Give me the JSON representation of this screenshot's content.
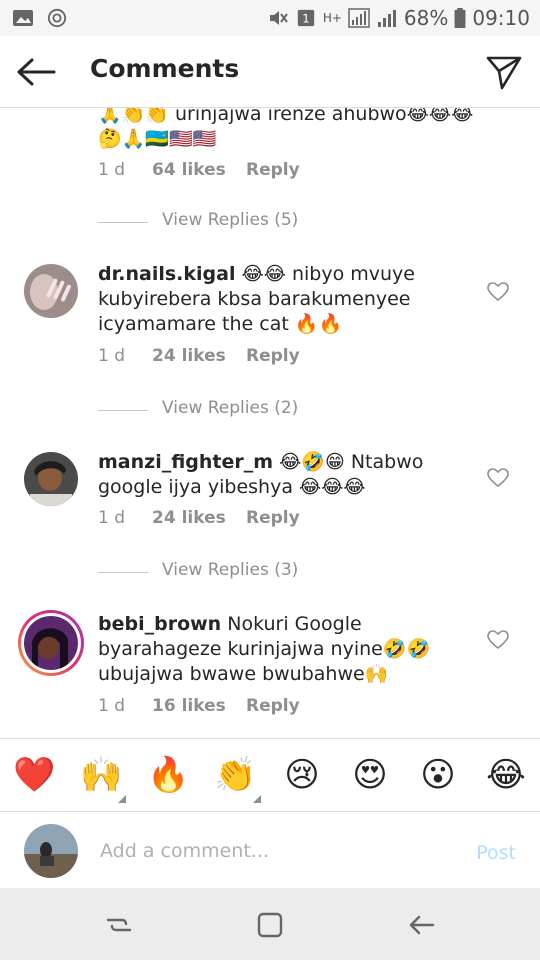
{
  "status_bar": {
    "battery_percent": "68%",
    "time": "09:10",
    "sim": "1",
    "network": "H+"
  },
  "header": {
    "title": "Comments"
  },
  "comments": [
    {
      "id": "c0",
      "text": "🙏👏👏 urinjajwa irenze ahubwo😂😂😂🤔🙏🇷🇼🇺🇸🇺🇸",
      "time": "1 d",
      "likes": "64 likes",
      "reply": "Reply",
      "view_replies": "View Replies (5)"
    },
    {
      "id": "c1",
      "username": "dr.nails.kigal",
      "text": " 😂😂 nibyo mvuye kubyirebera kbsa barakumenyee icyamamare the cat 🔥🔥",
      "time": "1 d",
      "likes": "24 likes",
      "reply": "Reply",
      "view_replies": "View Replies (2)"
    },
    {
      "id": "c2",
      "username": "manzi_fighter_m",
      "text": " 😂🤣😁 Ntabwo google ijya yibeshya 😂😂😂",
      "time": "1 d",
      "likes": "24 likes",
      "reply": "Reply",
      "view_replies": "View Replies (3)"
    },
    {
      "id": "c3",
      "username": "bebi_brown",
      "text": " Nokuri Google byarahageze kurinjajwa nyine🤣🤣 ubujajwa bwawe bwubahwe🙌",
      "time": "1 d",
      "likes": "16 likes",
      "reply": "Reply"
    }
  ],
  "emoji_bar": [
    "❤️",
    "🙌",
    "🔥",
    "👏",
    "😢",
    "😍",
    "😮",
    "😂"
  ],
  "composer": {
    "placeholder": "Add a comment...",
    "post_label": "Post"
  },
  "colors": {
    "accent_disabled": "#b3dbff",
    "secondary_text": "#8e8e8e",
    "divider": "#dbdbdb"
  }
}
